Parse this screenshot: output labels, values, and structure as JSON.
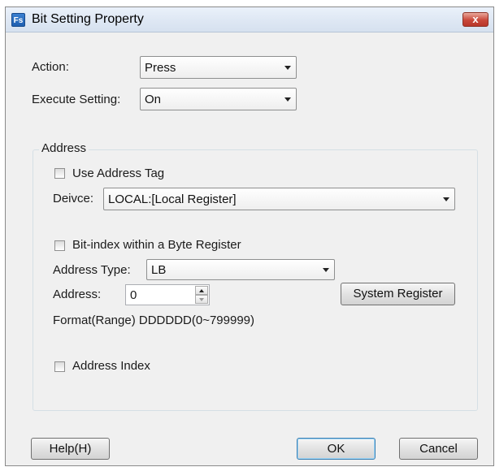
{
  "window": {
    "title": "Bit Setting Property",
    "app_icon": "Fs",
    "close_label": "x"
  },
  "action": {
    "label": "Action:",
    "value": "Press"
  },
  "execute": {
    "label": "Execute Setting:",
    "value": "On"
  },
  "address_group": {
    "legend": "Address",
    "use_tag": {
      "label": "Use Address Tag",
      "checked": false
    },
    "device": {
      "label": "Deivce:",
      "value": "LOCAL:[Local Register]"
    },
    "bit_index": {
      "label": "Bit-index within a Byte Register",
      "checked": false
    },
    "address_type": {
      "label": "Address Type:",
      "value": "LB"
    },
    "address": {
      "label": "Address:",
      "value": "0"
    },
    "system_register_label": "System Register",
    "format": "Format(Range) DDDDDD(0~799999)",
    "address_index": {
      "label": "Address Index",
      "checked": false
    }
  },
  "buttons": {
    "help": "Help(H)",
    "ok": "OK",
    "cancel": "Cancel"
  },
  "colors": {
    "window_bg": "#f0f0f0",
    "close_button": "#c9483a",
    "default_button_border": "#3c7fb1"
  }
}
